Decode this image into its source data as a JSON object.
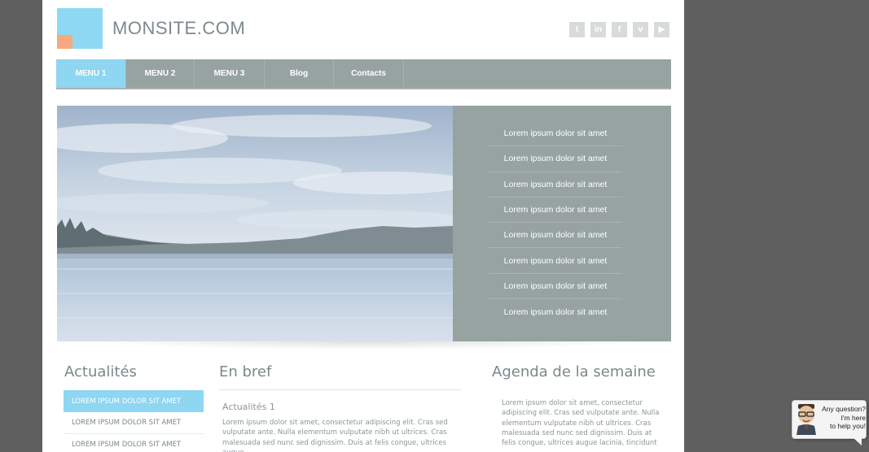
{
  "header": {
    "site_title": "MONSITE.COM",
    "social": [
      {
        "icon": "twitter-icon",
        "glyph": "t"
      },
      {
        "icon": "linkedin-icon",
        "glyph": "in"
      },
      {
        "icon": "facebook-icon",
        "glyph": "f"
      },
      {
        "icon": "vimeo-icon",
        "glyph": "v"
      },
      {
        "icon": "youtube-icon",
        "glyph": "▶"
      }
    ]
  },
  "nav": {
    "items": [
      {
        "label": "MENU 1",
        "active": true
      },
      {
        "label": "MENU 2",
        "active": false
      },
      {
        "label": "MENU 3",
        "active": false
      },
      {
        "label": "Blog",
        "active": false
      },
      {
        "label": "Contacts",
        "active": false
      }
    ]
  },
  "slider": {
    "side_items": [
      "Lorem ipsum dolor sit amet",
      "Lorem ipsum dolor sit amet",
      "Lorem ipsum dolor sit amet",
      "Lorem ipsum dolor sit amet",
      "Lorem ipsum dolor sit amet",
      "Lorem ipsum dolor sit amet",
      "Lorem ipsum dolor sit amet",
      "Lorem ipsum dolor sit amet"
    ]
  },
  "columns": {
    "news": {
      "title": "Actualités",
      "items": [
        {
          "label": "LOREM IPSUM DOLOR SIT AMET",
          "active": true
        },
        {
          "label": "LOREM IPSUM DOLOR SIT AMET",
          "active": false
        },
        {
          "label": "LOREM IPSUM DOLOR SIT AMET",
          "active": false
        }
      ]
    },
    "brief": {
      "title": "En bref",
      "subtitle": "Actualités 1",
      "text": "Lorem ipsum dolor sit amet, consectetur adipiscing elit. Cras sed vulputate ante. Nulla elementum vulputate nibh ut ultrices. Cras malesuada sed nunc sed dignissim. Duis at felis congue, ultrices augue"
    },
    "agenda": {
      "title": "Agenda de la semaine",
      "text": "Lorem ipsum dolor sit amet, consectetur adipiscing elit. Cras sed vulputate ante. Nulla elementum vulputate nibh ut ultrices. Cras malesuada sed nunc sed dignissim. Duis at felis congue, ultrices augue lacinia, tincidunt"
    }
  },
  "help": {
    "line1": "Any question?",
    "line2": "I'm here",
    "line3": "to help you!"
  },
  "colors": {
    "background": "#5f5f5f",
    "accent": "#8ed6f2",
    "nav": "#97a3a1",
    "logo_secondary": "#f5a97e"
  }
}
